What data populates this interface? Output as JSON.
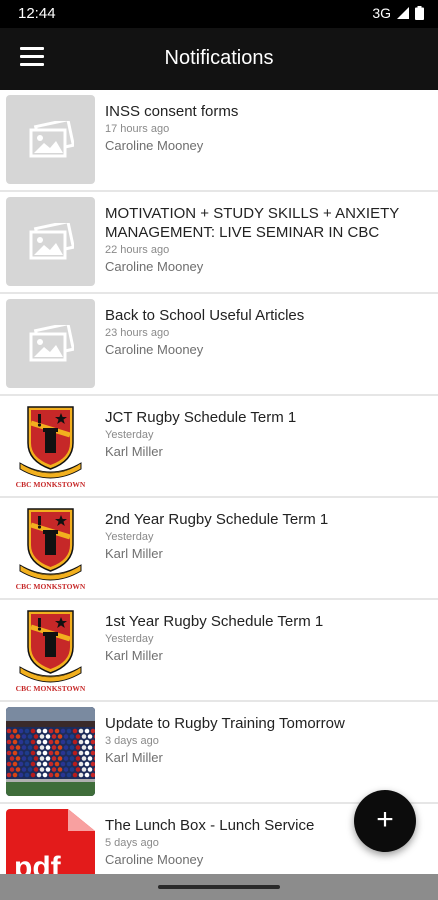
{
  "status": {
    "time": "12:44",
    "network": "3G"
  },
  "app_bar": {
    "title": "Notifications"
  },
  "notifications": [
    {
      "title": "INSS consent forms",
      "time": "17 hours ago",
      "author": "Caroline Mooney",
      "thumb": "placeholder"
    },
    {
      "title": "MOTIVATION + STUDY SKILLS + ANXIETY MANAGEMENT: LIVE SEMINAR IN CBC",
      "time": "22 hours ago",
      "author": "Caroline Mooney",
      "thumb": "placeholder"
    },
    {
      "title": "Back to School Useful Articles",
      "time": "23 hours ago",
      "author": "Caroline Mooney",
      "thumb": "placeholder"
    },
    {
      "title": "JCT Rugby Schedule Term 1",
      "time": "Yesterday",
      "author": "Karl Miller",
      "thumb": "crest"
    },
    {
      "title": "2nd Year Rugby Schedule Term 1",
      "time": "Yesterday",
      "author": "Karl Miller",
      "thumb": "crest"
    },
    {
      "title": "1st Year Rugby Schedule Term 1",
      "time": "Yesterday",
      "author": "Karl Miller",
      "thumb": "crest"
    },
    {
      "title": "Update to Rugby Training Tomorrow",
      "time": "3 days ago",
      "author": "Karl Miller",
      "thumb": "photo"
    },
    {
      "title": "The Lunch Box - Lunch Service",
      "time": "5 days ago",
      "author": "Caroline Mooney",
      "thumb": "pdf"
    }
  ],
  "crest_label": "CBC MONKSTOWN",
  "pdf_label": "pdf",
  "fab": {
    "label": "+"
  },
  "colors": {
    "app_bar": "#121212",
    "crest_red": "#c62828",
    "crest_gold": "#f2b01e",
    "fab": "#0c0c0c"
  }
}
